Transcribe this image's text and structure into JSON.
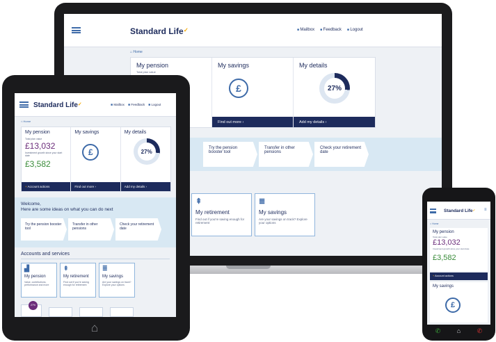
{
  "brand": {
    "name": "Standard Life",
    "accent": "#f5a800",
    "navy": "#1d2b5c",
    "blue": "#3d6aa8",
    "purple": "#6b2c7a",
    "green": "#3a8c3a"
  },
  "nav": {
    "mailbox": "Mailbox",
    "feedback": "Feedback",
    "logout": "Logout"
  },
  "breadcrumb": {
    "home": "Home"
  },
  "cards": {
    "pension": {
      "title": "My pension",
      "total_label": "Total plan value",
      "total_value": "£13,032",
      "growth_label": "Investment growth since your start date",
      "growth_value": "£3,582",
      "action": "Account actions"
    },
    "savings": {
      "title": "My savings",
      "icon": "pound-coin-icon",
      "action": "Find out more"
    },
    "details": {
      "title": "My details",
      "percent": "27%",
      "progress": 0.27,
      "action": "Add my details"
    }
  },
  "ideas": {
    "welcome": "Welcome,",
    "heading": "Here are some ideas on what you can do next",
    "items": [
      "Try the pension booster tool",
      "Transfer in other pensions",
      "Check your retirement date"
    ]
  },
  "accounts": {
    "heading": "Accounts and services",
    "tiles": [
      {
        "title": "My pension",
        "sub": "Value, contributions, performance and more",
        "icon": "chart-icon"
      },
      {
        "title": "My retirement",
        "sub": "Find out if you're saving enough for retirement",
        "icon": "signpost-icon"
      },
      {
        "title": "My savings",
        "sub": "Are your savings on track? Explore your options",
        "icon": "coins-icon"
      }
    ],
    "badge": "27%"
  },
  "laptop_partial": {
    "heading_fragment": "n",
    "section_fragment": "s"
  }
}
